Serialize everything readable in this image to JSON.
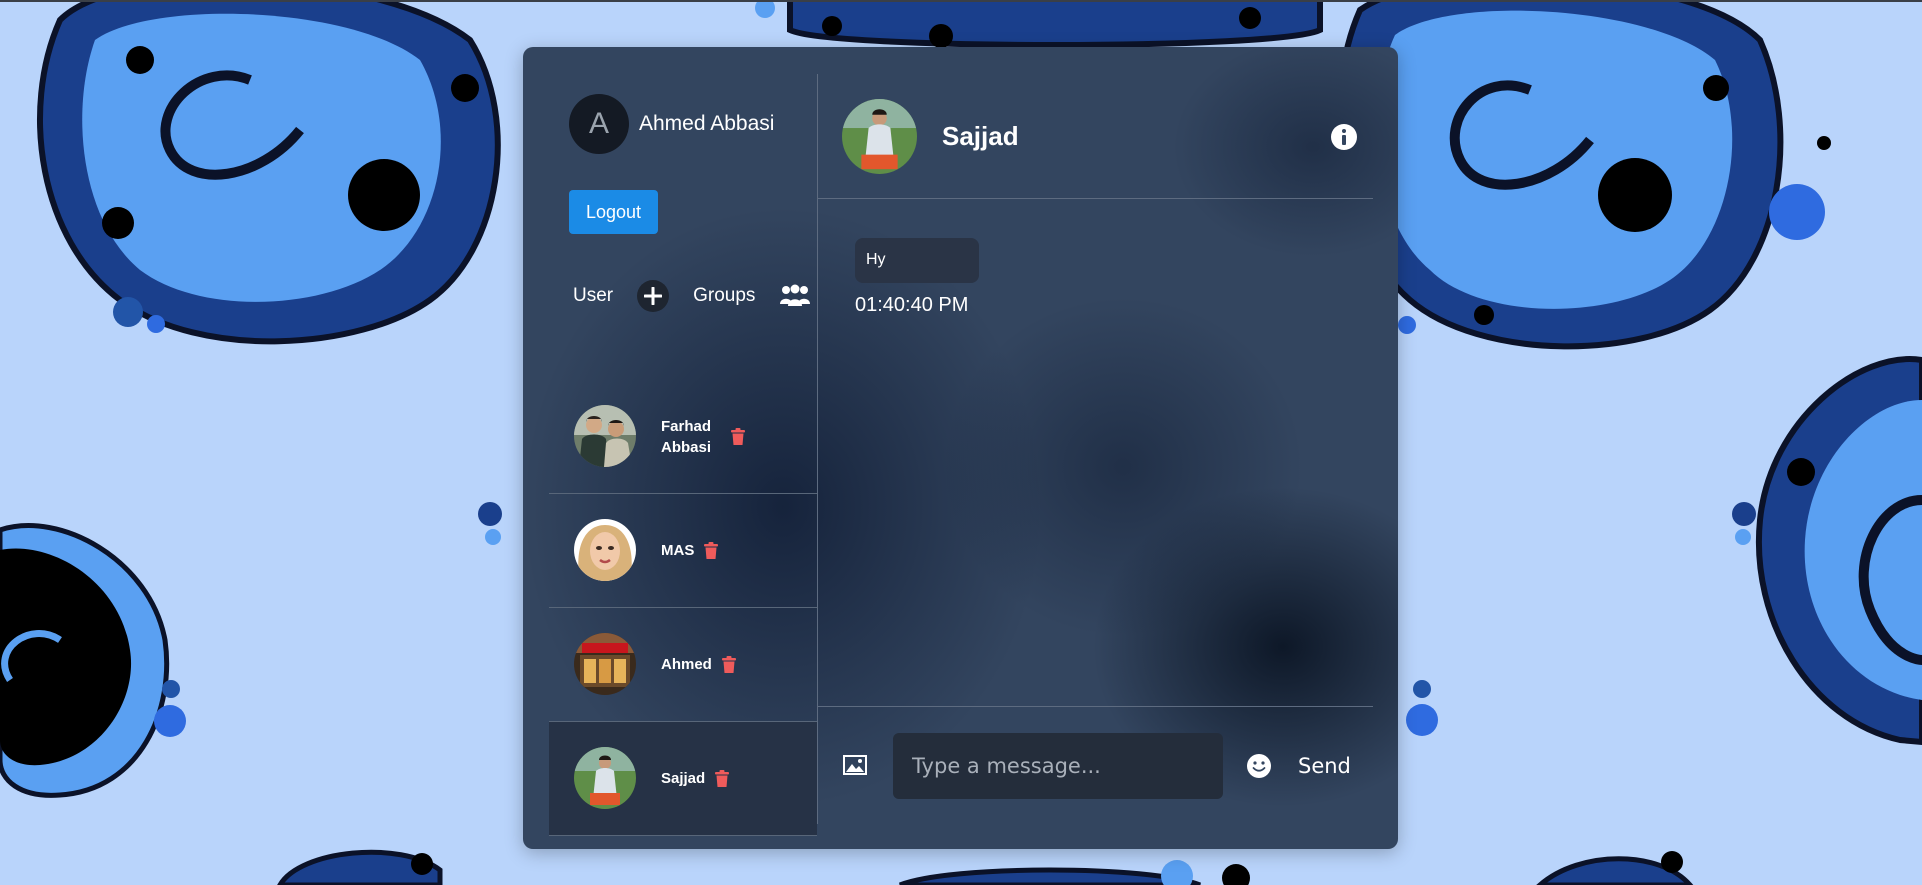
{
  "current_user": {
    "initial": "A",
    "name": "Ahmed Abbasi"
  },
  "logout_label": "Logout",
  "tabs": {
    "user_label": "User",
    "groups_label": "Groups"
  },
  "contacts": [
    {
      "name": "Farhad Abbasi"
    },
    {
      "name": "MAS"
    },
    {
      "name": "Ahmed"
    },
    {
      "name": "Sajjad"
    }
  ],
  "chat": {
    "contact_name": "Sajjad",
    "messages": [
      {
        "text": "Hy",
        "time": "01:40:40 PM"
      }
    ]
  },
  "composer": {
    "placeholder": "Type a message...",
    "send_label": "Send"
  },
  "colors": {
    "logout_button": "#1b8be6",
    "trash_icon": "#ef5b5b",
    "panel": "#33455f",
    "page_background": "#b9d4fb"
  },
  "icons": [
    "plus-icon",
    "groups-icon",
    "trash-icon",
    "info-icon",
    "image-icon",
    "emoji-icon"
  ]
}
